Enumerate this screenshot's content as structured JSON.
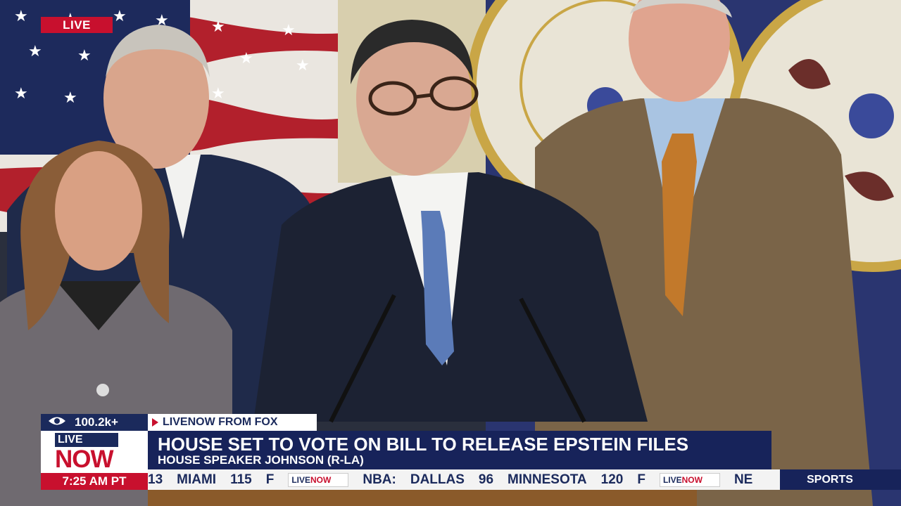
{
  "overlay": {
    "live_badge": "LIVE",
    "viewer_count": "100.2k+",
    "viewer_icon": "eye-icon",
    "logo_live": "LIVE",
    "logo_now": "NOW",
    "time": "7:25 AM PT",
    "source": "LIVENOW FROM FOX",
    "headline": "HOUSE SET TO VOTE ON BILL TO RELEASE EPSTEIN FILES",
    "subhead": "HOUSE SPEAKER JOHNSON (R-LA)",
    "ticker_items": [
      "13",
      "MIAMI",
      "115",
      "F",
      "NBA:",
      "DALLAS",
      "96",
      "MINNESOTA",
      "120",
      "F",
      "NE"
    ],
    "ticker_logo_live": "LIVE",
    "ticker_logo_now": "NOW",
    "sports_label": "SPORTS"
  },
  "colors": {
    "brand_red": "#c8102e",
    "brand_navy": "#17235a",
    "ticker_bg": "#f3f3f3"
  }
}
